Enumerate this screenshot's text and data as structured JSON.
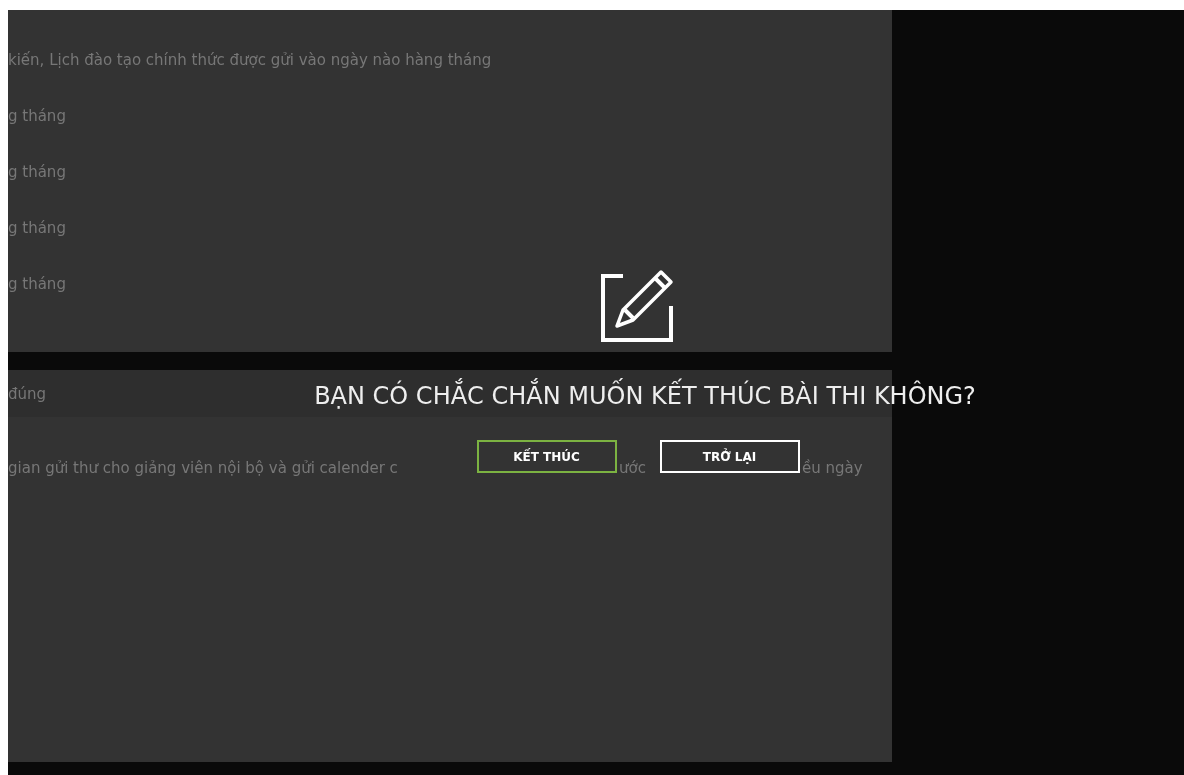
{
  "questions_panel": {
    "lines": [
      "kiến, Lịch đào tạo chính thức được gửi vào ngày nào hàng tháng",
      "g tháng",
      "g tháng",
      "g tháng",
      "g tháng"
    ]
  },
  "answers_panel": {
    "header": "đúng",
    "sentence_fragments": [
      "gian gửi thư cho giảng viên nội bộ và gửi calender c",
      "ước",
      "ều ngày"
    ]
  },
  "dialog": {
    "title": "BẠN CÓ CHẮC CHẮN MUỐN KẾT THÚC BÀI THI KHÔNG?",
    "buttons": [
      {
        "label": "KẾT THÚC",
        "kind": "primary"
      },
      {
        "label": "TRỞ LẠI",
        "kind": "secondary"
      }
    ]
  }
}
